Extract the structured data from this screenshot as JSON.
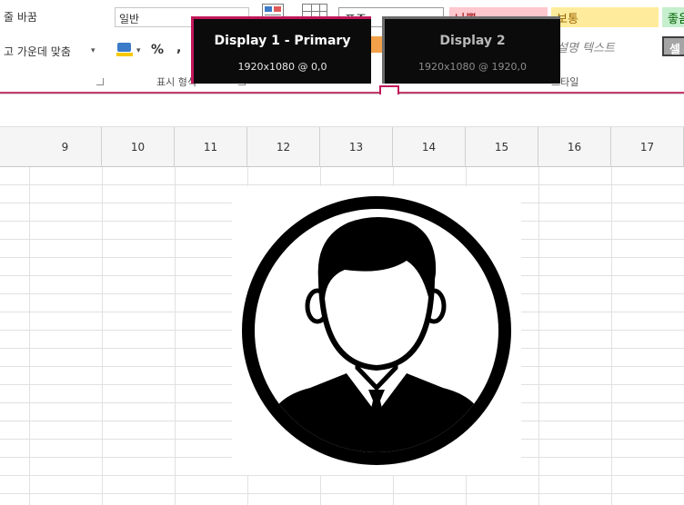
{
  "ribbon": {
    "wrap_text": "줄 바꿈",
    "merge_center": "고 가운데 맞춤",
    "merge_dropdown_arrow": "▾",
    "number_format_value": "일반",
    "currency_dropdown_arrow": "▾",
    "percent_label": "%",
    "comma_label": ",",
    "number_group_label": "표시 형식",
    "style_group_label": "스타일",
    "styles": {
      "standard": "표준",
      "bad": "나쁨",
      "normal": "보통",
      "good": "좋음",
      "explanatory": "설명 텍스트",
      "check_cell": "셀"
    }
  },
  "displays": [
    {
      "title": "Display 1 - Primary",
      "resolution": "1920x1080 @ 0,0",
      "active": true
    },
    {
      "title": "Display 2",
      "resolution": "1920x1080 @ 1920,0",
      "active": false
    }
  ],
  "columns": [
    "9",
    "10",
    "11",
    "12",
    "13",
    "14",
    "15",
    "16",
    "17"
  ],
  "colors": {
    "accent": "#c43b6d",
    "display_active_border": "#c2185b",
    "display_inactive_border": "#6c6c6c"
  },
  "image": {
    "icon": "user-avatar-icon"
  }
}
